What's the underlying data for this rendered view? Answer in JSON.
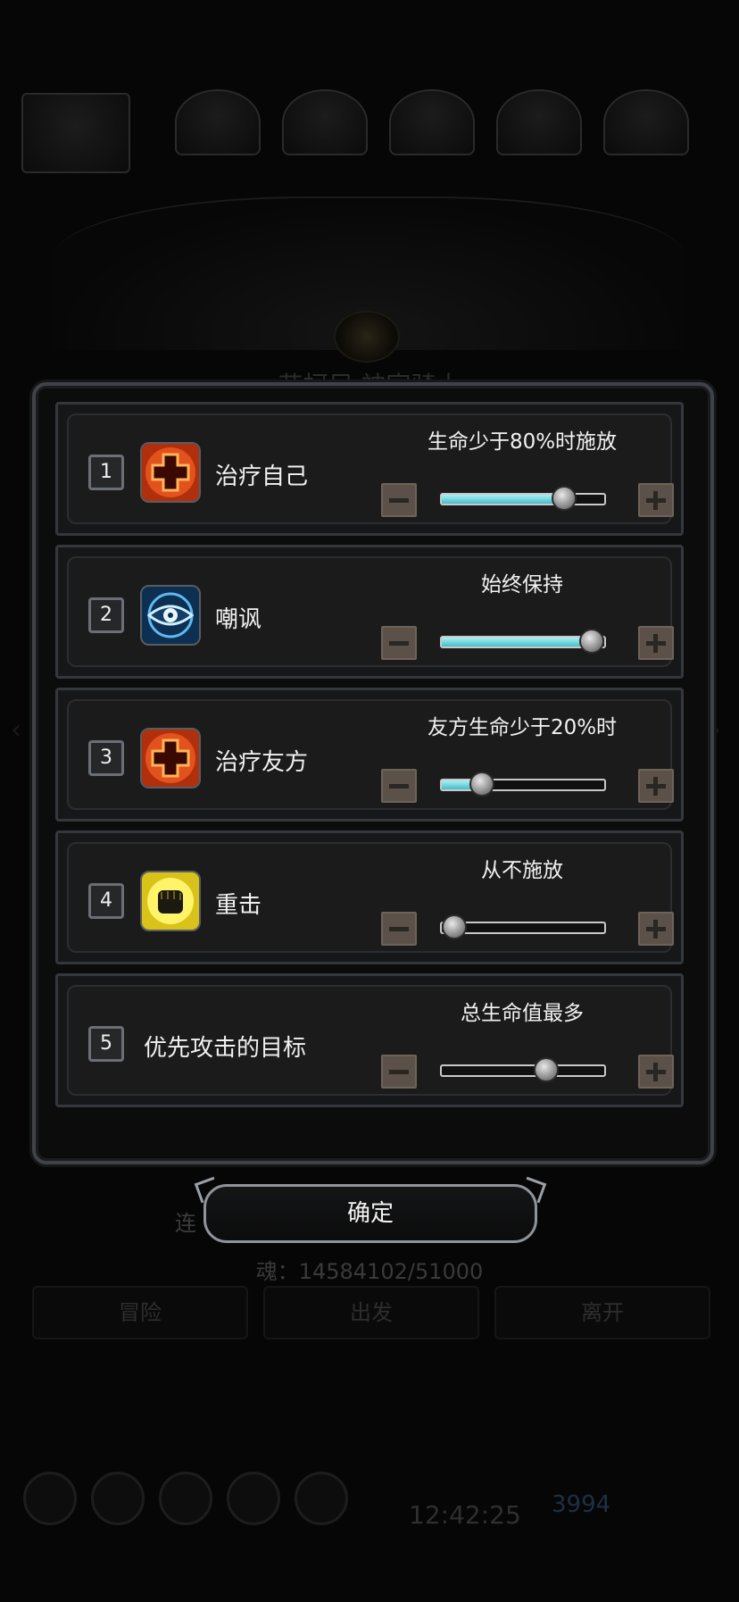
{
  "background": {
    "title": "艾柯尼 神官骑士",
    "combo_label": "连",
    "soul_text": "魂：14584102/51000",
    "buttons": [
      "冒险",
      "出发",
      "离开"
    ],
    "clock": "12:42:25",
    "gem_count": "3994"
  },
  "rows": [
    {
      "number": "1",
      "icon": "heal-cross-icon",
      "label": "治疗自己",
      "condition": "生命少于80%时施放",
      "slider_value": 0.8,
      "filled": true
    },
    {
      "number": "2",
      "icon": "eye-taunt-icon",
      "label": "嘲讽",
      "condition": "始终保持",
      "slider_value": 1.0,
      "filled": true
    },
    {
      "number": "3",
      "icon": "heal-cross-icon",
      "label": "治疗友方",
      "condition": "友方生命少于20%时",
      "slider_value": 0.2,
      "filled": true
    },
    {
      "number": "4",
      "icon": "fist-strike-icon",
      "label": "重击",
      "condition": "从不施放",
      "slider_value": 0.0,
      "filled": false
    },
    {
      "number": "5",
      "icon": "",
      "label": "优先攻击的目标",
      "condition": "总生命值最多",
      "slider_value": 0.67,
      "filled": false
    }
  ],
  "confirm_label": "确定",
  "colors": {
    "slider_fill": "#49bcc8",
    "frame": "#3f4246",
    "step_button": "#5b5148"
  }
}
